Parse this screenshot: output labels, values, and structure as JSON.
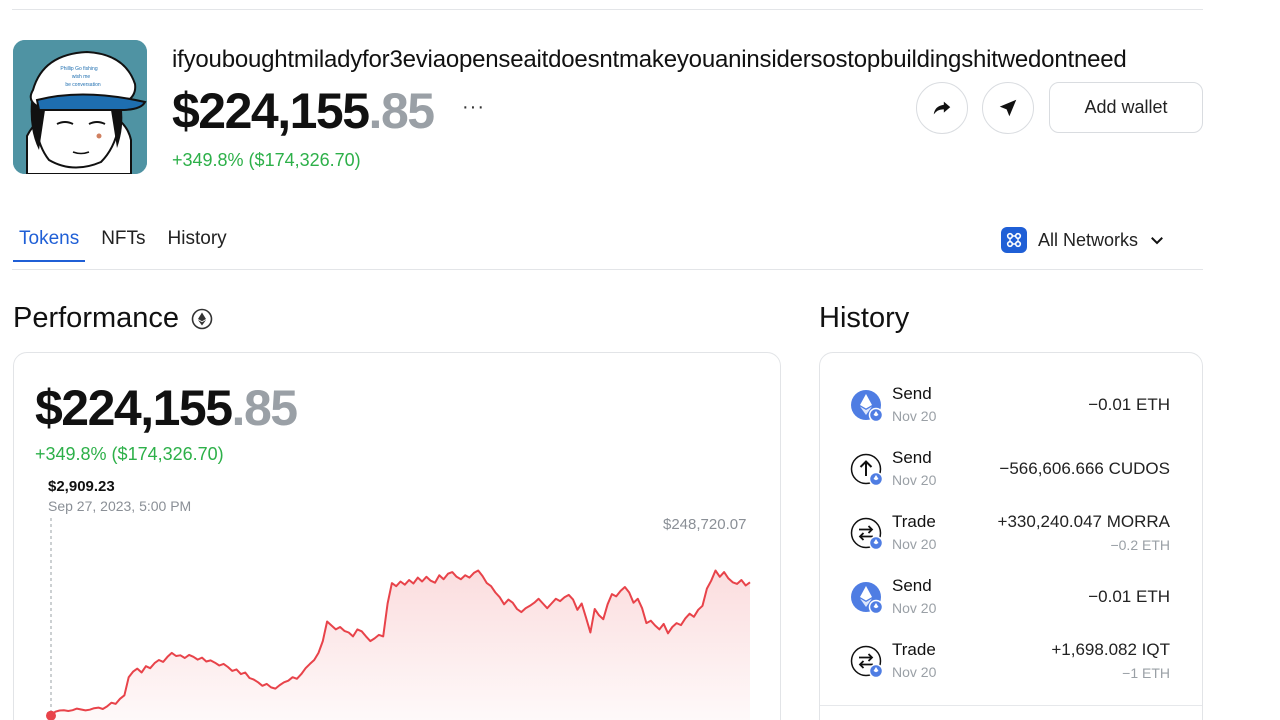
{
  "header": {
    "wallet_name": "ifyouboughtmiladyfor3eviaopenseaitdoesntmakeyouaninsidersostopbuildingshitwedontneed",
    "balance_main": "$224,155",
    "balance_cents": ".85",
    "more_label": "···",
    "change": "+349.8% ($174,326.70)",
    "add_wallet_label": "Add wallet",
    "avatar_cap_text": "Phillip Go fishing wish me be conversation"
  },
  "tabs": [
    {
      "label": "Tokens",
      "active": true
    },
    {
      "label": "NFTs",
      "active": false
    },
    {
      "label": "History",
      "active": false
    }
  ],
  "networks": {
    "label": "All Networks",
    "icon": "network-grid-icon"
  },
  "performance": {
    "title": "Performance",
    "balance_main": "$224,155",
    "balance_cents": ".85",
    "change": "+349.8% ($174,326.70)",
    "hover_value": "$2,909.23",
    "hover_date": "Sep 27, 2023, 5:00 PM",
    "max_label": "$248,720.07"
  },
  "chart_data": {
    "type": "line",
    "title": "",
    "xlabel": "",
    "ylabel": "",
    "color": "#e8434a",
    "ylim": [
      0,
      255000
    ],
    "values": [
      2909,
      8000,
      9500,
      9800,
      8900,
      10000,
      12000,
      10800,
      9700,
      10600,
      12500,
      13200,
      11500,
      14800,
      19500,
      18000,
      24500,
      29000,
      52000,
      59000,
      63000,
      58000,
      66000,
      63500,
      70000,
      74000,
      71500,
      78000,
      83000,
      79000,
      80000,
      76500,
      80500,
      78000,
      74500,
      77000,
      72000,
      73500,
      70500,
      67000,
      69000,
      65000,
      60000,
      62000,
      56000,
      58000,
      51000,
      49000,
      45500,
      41000,
      43500,
      39000,
      37500,
      42000,
      45500,
      47500,
      52000,
      50000,
      56000,
      63500,
      69000,
      74000,
      83000,
      98000,
      123000,
      118000,
      113000,
      116000,
      111000,
      109000,
      104000,
      113000,
      110500,
      104000,
      98000,
      101500,
      106000,
      104000,
      146000,
      172000,
      168000,
      174000,
      170000,
      176000,
      171500,
      179000,
      174000,
      180000,
      175000,
      172500,
      182000,
      177000,
      184000,
      186000,
      180000,
      177000,
      182000,
      179000,
      185000,
      188000,
      181000,
      172000,
      168000,
      160000,
      154000,
      145000,
      151000,
      147000,
      139000,
      135000,
      140000,
      143000,
      147000,
      152000,
      146000,
      140000,
      146000,
      152000,
      149000,
      154000,
      157000,
      151000,
      138000,
      146000,
      128000,
      109000,
      139000,
      131000,
      126000,
      145000,
      158000,
      155000,
      162000,
      167000,
      160000,
      147000,
      152000,
      140000,
      121000,
      124000,
      118000,
      113000,
      120000,
      108000,
      116000,
      121000,
      118500,
      127000,
      133000,
      129000,
      138000,
      143000,
      165000,
      175000,
      188000,
      180000,
      186000,
      178000,
      173000,
      171000,
      176000,
      169000,
      173000
    ]
  },
  "history": {
    "title": "History",
    "items": [
      {
        "type": "Send",
        "date": "Nov 20",
        "amount": "−0.01 ETH",
        "sub": "",
        "icon": "ethereum-icon"
      },
      {
        "type": "Send",
        "date": "Nov 20",
        "amount": "−566,606.666 CUDOS",
        "sub": "",
        "icon": "send-arrow-icon"
      },
      {
        "type": "Trade",
        "date": "Nov 20",
        "amount": "+330,240.047 MORRA",
        "sub": "−0.2 ETH",
        "icon": "trade-arrows-icon"
      },
      {
        "type": "Send",
        "date": "Nov 20",
        "amount": "−0.01 ETH",
        "sub": "",
        "icon": "ethereum-icon"
      },
      {
        "type": "Trade",
        "date": "Nov 20",
        "amount": "+1,698.082 IQT",
        "sub": "−1 ETH",
        "icon": "trade-arrows-icon"
      }
    ]
  },
  "colors": {
    "accent": "#1f5fd6",
    "positive": "#2db049",
    "chart_line": "#e8434a",
    "muted": "#9aa0a6"
  }
}
